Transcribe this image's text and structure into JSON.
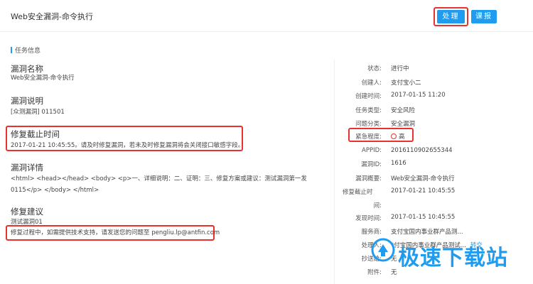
{
  "header": {
    "title": "Web安全漏洞-命令执行",
    "process_label": "处理",
    "course_label": "课报"
  },
  "section": {
    "title": "任务信息"
  },
  "left": [
    {
      "label": "漏洞名称",
      "value": "Web安全漏洞-命令执行"
    },
    {
      "label": "漏洞说明",
      "value": "[众测漏洞] 011501"
    },
    {
      "label": "修复截止时间",
      "value": "2017-01-21 10:45:55。请及时修复漏洞，若未及时修复漏洞将会关闭接口敏感字段。"
    },
    {
      "label": "漏洞详情",
      "value_line1": "<html> <head></head> <body> <p>一、详细说明：二、证明：三、修复方案或建议：测试漏洞第一发",
      "value_line2": "0115</p> </body> </html>"
    },
    {
      "label": "修复建议",
      "value_line1": "测试漏洞01",
      "value_line2": "修复过程中，如需提供技术支持，请发送您的问题至 pengliu.lp@antfin.com"
    }
  ],
  "right": [
    {
      "key": "状态:",
      "value": "进行中"
    },
    {
      "key": "创建人:",
      "value": "支付宝小二"
    },
    {
      "key": "创建时间:",
      "value": "2017-01-15 11:20"
    },
    {
      "key": "任务类型:",
      "value": "安全风险"
    },
    {
      "key": "问题分类:",
      "value": "安全漏洞"
    },
    {
      "key": "紧急程度:",
      "value": "高"
    },
    {
      "key": "APPID:",
      "value": "2016110902655344"
    },
    {
      "key": "漏洞ID:",
      "value": "1616"
    },
    {
      "key": "漏洞概要:",
      "value": "Web安全漏洞-命令执行"
    },
    {
      "key": "修复截止时",
      "key2": "间:",
      "value": "2017-01-21 10:45:55"
    },
    {
      "key": "发现时间:",
      "value": "2017-01-15 10:45:55"
    },
    {
      "key": "服务商:",
      "value": "支付宝国内事业群产品测..."
    },
    {
      "key": "处理人:",
      "value": "*付宝国内事业群产品测试...",
      "link": "转交"
    },
    {
      "key": "抄送给:",
      "value": "无"
    },
    {
      "key": "附件:",
      "value": "无"
    }
  ],
  "watermark": {
    "text": "极速下载站"
  },
  "colors": {
    "accent": "#1f9cf0",
    "highlight": "#e8322f"
  }
}
